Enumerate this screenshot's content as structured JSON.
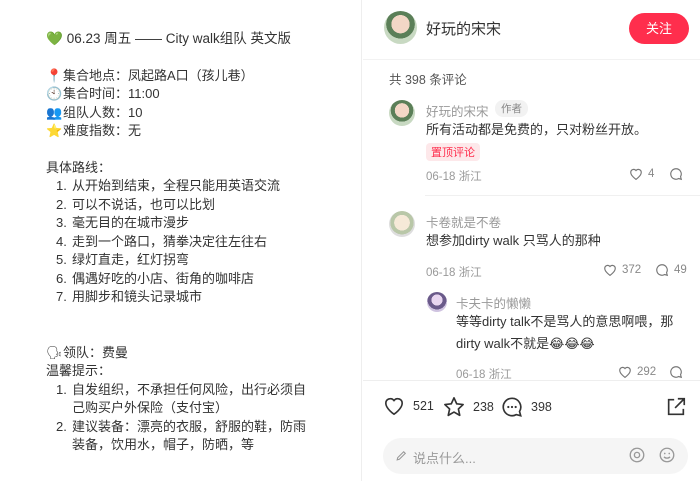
{
  "note": {
    "title_emoji": "💚",
    "title": "06.23 周五 —— City walk组队 英文版",
    "info": [
      {
        "emoji": "📍",
        "text": "集合地点：凤起路A口（孩儿巷）"
      },
      {
        "emoji": "🕙",
        "text": "集合时间：11:00"
      },
      {
        "emoji": "👥",
        "text": "组队人数：10"
      },
      {
        "emoji": "⭐",
        "text": "难度指数：无"
      }
    ],
    "route_heading": "具体路线：",
    "route": [
      {
        "num": "1.",
        "text": "从开始到结束，全程只能用英语交流"
      },
      {
        "num": "2.",
        "text": "可以不说话，也可以比划"
      },
      {
        "num": "3.",
        "text": "毫无目的在城市漫步"
      },
      {
        "num": "4.",
        "text": "走到一个路口，猜拳决定往左往右"
      },
      {
        "num": "5.",
        "text": "绿灯直走，红灯拐弯"
      },
      {
        "num": "6.",
        "text": "偶遇好吃的小店、街角的咖啡店"
      },
      {
        "num": "7.",
        "text": "用脚步和镜头记录城市"
      }
    ],
    "leader_emoji": "🗣",
    "leader": "领队：费曼",
    "tips_heading": "温馨提示：",
    "tips": [
      {
        "num": "1.",
        "text": "自发组织，不承担任何风险，出行必须自己购买户外保险（支付宝）"
      },
      {
        "num": "2.",
        "text": "建议装备：漂亮的衣服，舒服的鞋，防雨装备，饮用水，帽子，防晒，等"
      }
    ]
  },
  "header": {
    "author": "好玩的宋宋",
    "follow_label": "关注"
  },
  "comments_count": "共 398 条评论",
  "comments": [
    {
      "name": "好玩的宋宋",
      "tag": "作者",
      "text": "所有活动都是免费的，只对粉丝开放。",
      "pin": "置顶评论",
      "date": "06-18",
      "location": "浙江",
      "likes": "4"
    },
    {
      "name": "卡卷就是不卷",
      "text": "想参加dirty walk 只骂人的那种",
      "date": "06-18",
      "location": "浙江",
      "likes": "372",
      "replies": "49"
    },
    {
      "name": "卡夫卡的懒懒",
      "text": "等等dirty talk不是骂人的意思啊喂，那dirty walk不就是😂😂😂",
      "date": "06-18",
      "location": "浙江",
      "likes": "292"
    }
  ],
  "bottom": {
    "likes": "521",
    "stars": "238",
    "comments": "398",
    "placeholder": "说点什么..."
  },
  "colors": {
    "accent": "#ff2e4d",
    "text": "#333333",
    "muted": "#999999"
  }
}
